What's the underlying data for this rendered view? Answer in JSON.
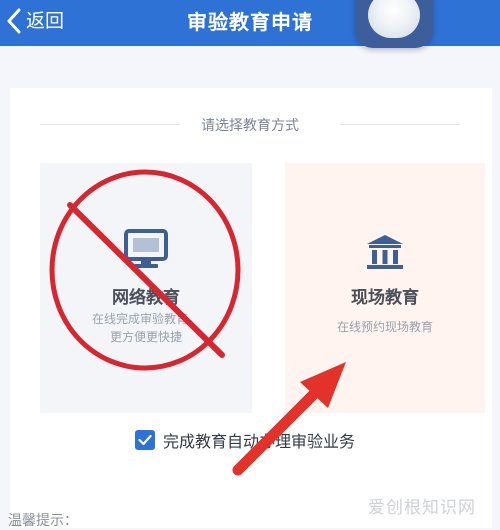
{
  "header": {
    "back_label": "返回",
    "title": "审验教育申请"
  },
  "main": {
    "prompt": "请选择教育方式",
    "options": [
      {
        "title": "网络教育",
        "subtitle_line1": "在线完成审验教育，",
        "subtitle_line2": "更方便更快捷",
        "icon": "monitor-icon"
      },
      {
        "title": "现场教育",
        "subtitle": "在线预约现场教育",
        "icon": "building-icon"
      }
    ],
    "checkbox_label": "完成教育自动办理审验业务",
    "checkbox_checked": true,
    "hint_label": "温馨提示："
  },
  "watermark": "爱创根知识网",
  "colors": {
    "accent": "#2f72d6",
    "annotation_red": "#d8262f"
  }
}
